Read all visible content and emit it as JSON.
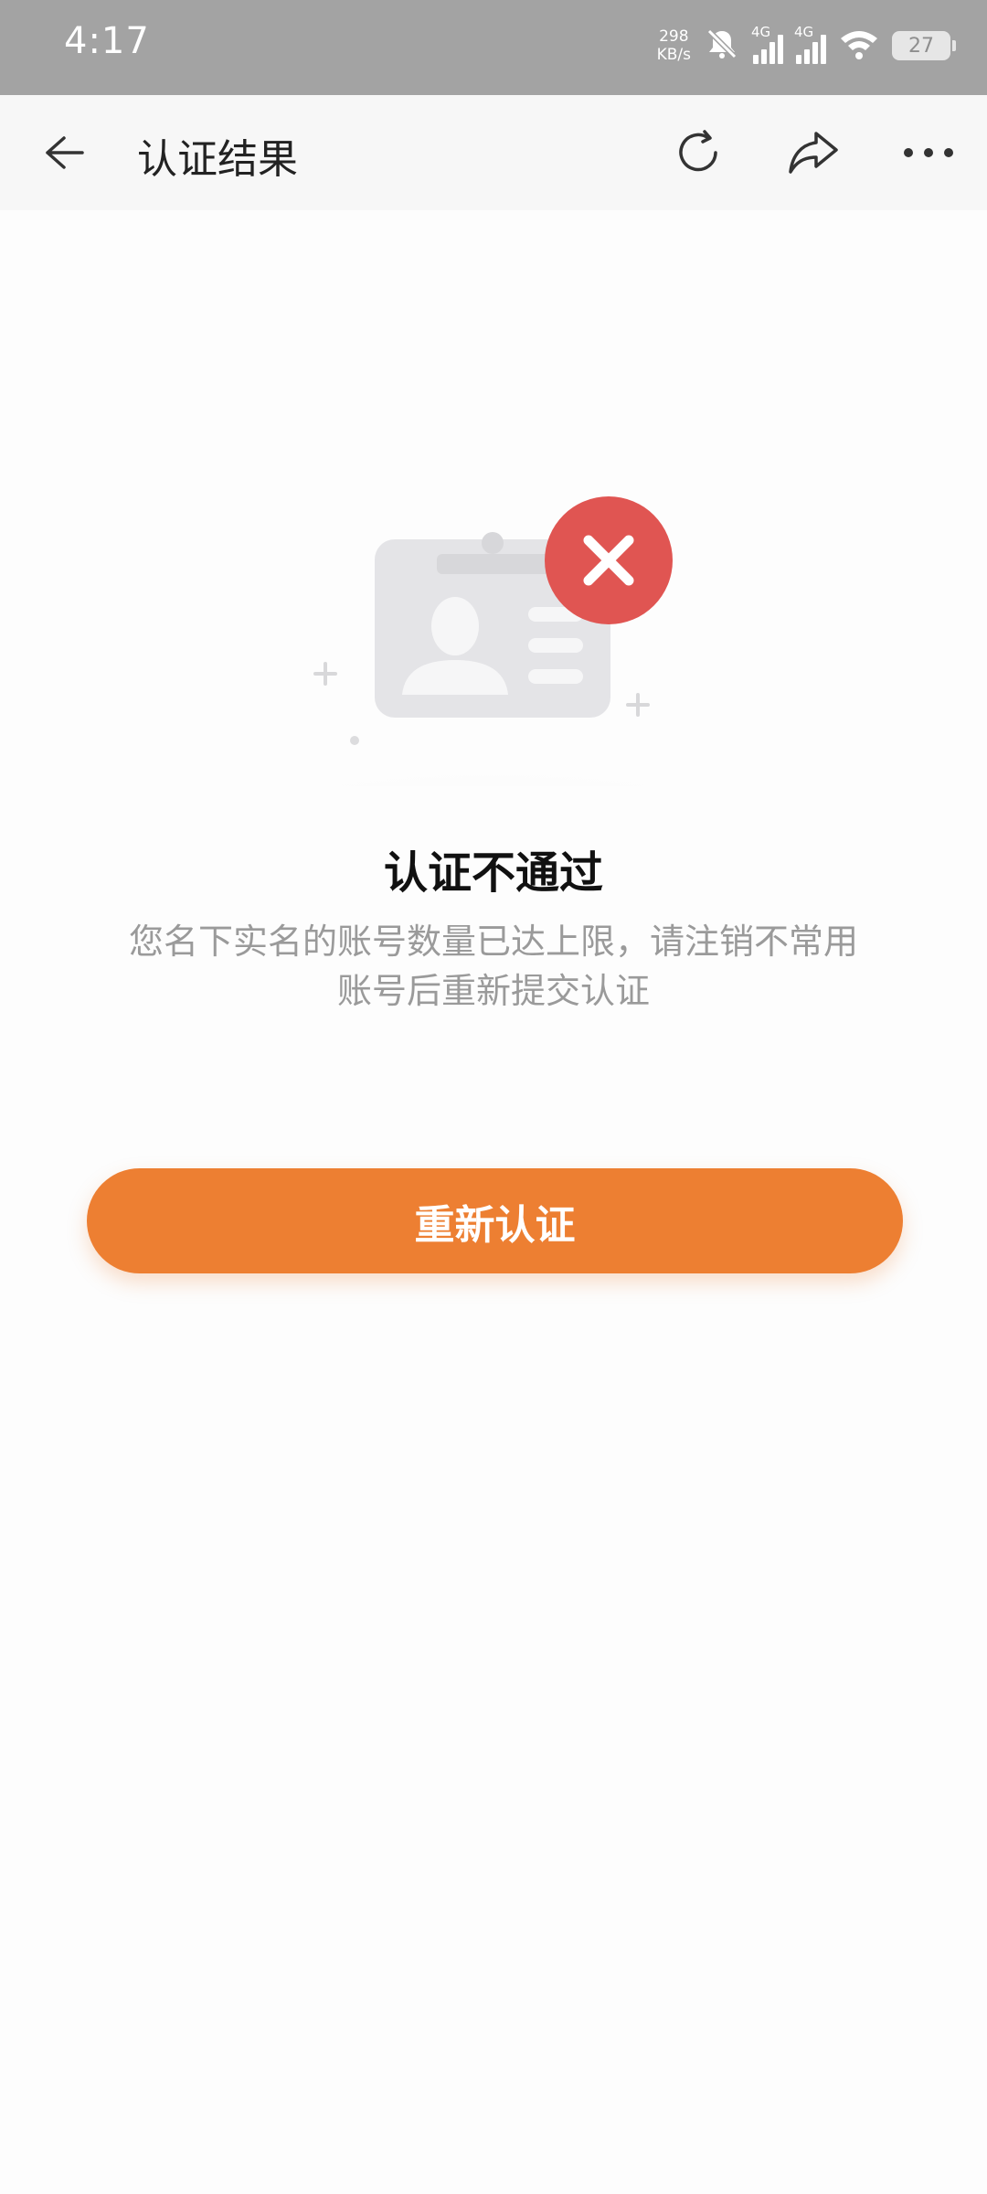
{
  "status_bar": {
    "time": "4:17",
    "net_speed_value": "298",
    "net_speed_unit": "KB/s",
    "sim1_label": "4G",
    "sim2_label": "4G",
    "battery": "27"
  },
  "header": {
    "title": "认证结果"
  },
  "result": {
    "title": "认证不通过",
    "description": "您名下实名的账号数量已达上限，请注销不常用账号后重新提交认证"
  },
  "actions": {
    "retry_label": "重新认证"
  },
  "colors": {
    "accent": "#ed7f32",
    "error": "#e05552",
    "status_bar_bg": "#a3a3a3"
  }
}
